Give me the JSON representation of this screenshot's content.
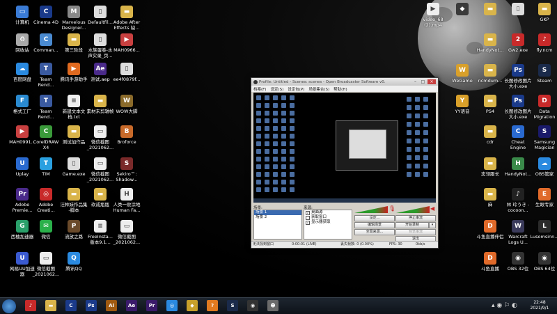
{
  "desktop_icons": [
    {
      "label": "计算机",
      "icon": "computer-icon",
      "color": "#3a7bd5",
      "glyph": "▭"
    },
    {
      "label": "Cinema 4D",
      "icon": "cinema4d-icon",
      "color": "#1a3a8a",
      "glyph": "C"
    },
    {
      "label": "Marvelous\nDesigner...",
      "icon": "marvelous-icon",
      "color": "#888",
      "glyph": "M"
    },
    {
      "label": "Defaultfil...",
      "icon": "file-icon",
      "color": "#ddd",
      "glyph": "▯"
    },
    {
      "label": "Adobe After\nEffects 缺...",
      "icon": "folder-icon",
      "color": "#d9b44a",
      "glyph": "▬"
    },
    {
      "label": "回收站",
      "icon": "recycle-bin-icon",
      "color": "#aaa",
      "glyph": "♻"
    },
    {
      "label": "Comman...",
      "icon": "command-icon",
      "color": "#4a8ad0",
      "glyph": "C"
    },
    {
      "label": "第三阶段",
      "icon": "folder-icon",
      "color": "#d9b44a",
      "glyph": "▬"
    },
    {
      "label": "水族蛋卷-水\n声实录_页...",
      "icon": "file-icon",
      "color": "#ddd",
      "glyph": "▯"
    },
    {
      "label": "MAH0966...",
      "icon": "video-icon",
      "color": "#c84040",
      "glyph": "▶"
    },
    {
      "label": "百度网盘",
      "icon": "baidu-icon",
      "color": "#2a8ae0",
      "glyph": "☁"
    },
    {
      "label": "Team\nRend...",
      "icon": "team-render-icon",
      "color": "#3a5aa0",
      "glyph": "T"
    },
    {
      "label": "腾讯手游助手",
      "icon": "tencent-game-icon",
      "color": "#e06a20",
      "glyph": "▶"
    },
    {
      "label": "测试.aep",
      "icon": "ae-file-icon",
      "color": "#4a2a8a",
      "glyph": "Ae"
    },
    {
      "label": "ee4f0879f...",
      "icon": "file-icon",
      "color": "#ddd",
      "glyph": "▯"
    },
    {
      "label": "格式工厂",
      "icon": "format-factory-icon",
      "color": "#2a8ad0",
      "glyph": "F"
    },
    {
      "label": "Team\nRend...",
      "icon": "team-render-icon",
      "color": "#3a5aa0",
      "glyph": "T"
    },
    {
      "label": "新建文本文\n档.txt",
      "icon": "text-file-icon",
      "color": "#eee",
      "glyph": "≡"
    },
    {
      "label": "素材未剪辑帧",
      "icon": "folder-icon",
      "color": "#d9b44a",
      "glyph": "▬"
    },
    {
      "label": "WOW大脚",
      "icon": "wow-icon",
      "color": "#8a6a2a",
      "glyph": "W"
    },
    {
      "label": "MAH0991...",
      "icon": "video-icon",
      "color": "#c84040",
      "glyph": "▶"
    },
    {
      "label": "CorelDRAW\nX4",
      "icon": "coreldraw-icon",
      "color": "#3a9a3a",
      "glyph": "C"
    },
    {
      "label": "测试加作品",
      "icon": "folder-icon",
      "color": "#d9b44a",
      "glyph": "▬"
    },
    {
      "label": "微信截图\n_2021062...",
      "icon": "image-file-icon",
      "color": "#eee",
      "glyph": "▭"
    },
    {
      "label": "Broforce",
      "icon": "broforce-icon",
      "color": "#c86a2a",
      "glyph": "B"
    },
    {
      "label": "Uplay",
      "icon": "uplay-icon",
      "color": "#2a6ad0",
      "glyph": "U"
    },
    {
      "label": "TIM",
      "icon": "tim-icon",
      "color": "#2aa0e0",
      "glyph": "T"
    },
    {
      "label": "Game.exe",
      "icon": "exe-icon",
      "color": "#ddd",
      "glyph": "▯"
    },
    {
      "label": "微信截图\n_2021062...",
      "icon": "image-file-icon",
      "color": "#eee",
      "glyph": "▭"
    },
    {
      "label": "Sekiro™:\nShadow...",
      "icon": "sekiro-icon",
      "color": "#7a2a2a",
      "glyph": "S"
    },
    {
      "label": "Adobe\nPremie...",
      "icon": "premiere-icon",
      "color": "#4a2a8a",
      "glyph": "Pr"
    },
    {
      "label": "Adobe\nCreati...",
      "icon": "creative-cloud-icon",
      "color": "#c82a2a",
      "glyph": "◎"
    },
    {
      "label": "汪林妹作品集\n-脚本",
      "icon": "folder-icon",
      "color": "#d9b44a",
      "glyph": "▬"
    },
    {
      "label": "砍戒瓶瓶",
      "icon": "folder-icon",
      "color": "#d9b44a",
      "glyph": "▬"
    },
    {
      "label": "人类一败涂地\nHuman Fa...",
      "icon": "human-fall-flat-icon",
      "color": "#eee",
      "glyph": "H"
    },
    {
      "label": "西柚加速器",
      "icon": "grapefruit-icon",
      "color": "#2aa06a",
      "glyph": "G"
    },
    {
      "label": "微信",
      "icon": "wechat-icon",
      "color": "#2ab04a",
      "glyph": "✉"
    },
    {
      "label": "流放之路",
      "icon": "path-of-exile-icon",
      "color": "#6a4a2a",
      "glyph": "P"
    },
    {
      "label": "FreeInsta...\n版本9.1...",
      "icon": "text-file-icon",
      "color": "#eee",
      "glyph": "≡"
    },
    {
      "label": "微信截图\n_2021062...",
      "icon": "image-file-icon",
      "color": "#eee",
      "glyph": "▭"
    },
    {
      "label": "网易UU加速\n器",
      "icon": "uu-icon",
      "color": "#3a5ad0",
      "glyph": "U"
    },
    {
      "label": "微信截图\n_2021062...",
      "icon": "image-file-icon",
      "color": "#eee",
      "glyph": "▭"
    },
    {
      "label": "腾讯QQ",
      "icon": "qq-icon",
      "color": "#2a8ae0",
      "glyph": "Q"
    },
    {
      "label": "video_68\n(2).mp4",
      "icon": "video-icon",
      "color": "#eee",
      "glyph": "▶"
    },
    {
      "label": "",
      "icon": "game-icon",
      "color": "#3a3a3a",
      "glyph": "◆"
    },
    {
      "label": "",
      "icon": "folder-icon",
      "color": "#d9b44a",
      "glyph": "▬"
    },
    {
      "label": "",
      "icon": "file-icon",
      "color": "#ddd",
      "glyph": "▯"
    },
    {
      "label": "GKP",
      "icon": "folder-icon",
      "color": "#d9b44a",
      "glyph": "▬"
    },
    {
      "label": "HandyNot...",
      "icon": "folder-icon",
      "color": "#d9b44a",
      "glyph": "▬"
    },
    {
      "label": "Gw2.exe",
      "icon": "gw2-icon",
      "color": "#c82a2a",
      "glyph": "2"
    },
    {
      "label": "fly.ncm",
      "icon": "netease-music-icon",
      "color": "#c82a2a",
      "glyph": "♪"
    },
    {
      "label": "WeGame",
      "icon": "wegame-icon",
      "color": "#d9a02a",
      "glyph": "W"
    },
    {
      "label": "ncmdum...",
      "icon": "folder-icon",
      "color": "#d9b44a",
      "glyph": "▬"
    },
    {
      "label": "长图修改图片\n大小.exe",
      "icon": "ps-exe-icon",
      "color": "#1a3a8a",
      "glyph": "Ps"
    },
    {
      "label": "Steam",
      "icon": "steam-icon",
      "color": "#1a2a4a",
      "glyph": "S"
    },
    {
      "label": "YY语音",
      "icon": "yy-icon",
      "color": "#d9a02a",
      "glyph": "Y"
    },
    {
      "label": "PS4",
      "icon": "folder-icon",
      "color": "#d9b44a",
      "glyph": "▬"
    },
    {
      "label": "长图修改图片\n大小.exe",
      "icon": "ps-exe-icon",
      "color": "#1a3a8a",
      "glyph": "Ps"
    },
    {
      "label": "Data\nMigration",
      "icon": "data-migration-icon",
      "color": "#c82a2a",
      "glyph": "D"
    },
    {
      "label": "cdr",
      "icon": "folder-icon",
      "color": "#d9b44a",
      "glyph": "▬"
    },
    {
      "label": "Cheat\nEngine",
      "icon": "cheat-engine-icon",
      "color": "#2a6ad0",
      "glyph": "C"
    },
    {
      "label": "Samsung\nMagician",
      "icon": "samsung-icon",
      "color": "#1a1a6a",
      "glyph": "S"
    },
    {
      "label": "志领服长",
      "icon": "folder-icon",
      "color": "#d9b44a",
      "glyph": "▬"
    },
    {
      "label": "HandyNot...",
      "icon": "handynote-icon",
      "color": "#3a8a4a",
      "glyph": "H"
    },
    {
      "label": "OBS管家",
      "icon": "obs-assistant-icon",
      "color": "#2a8ae0",
      "glyph": "☁"
    },
    {
      "label": "麻",
      "icon": "folder-icon",
      "color": "#d9b44a",
      "glyph": "▬"
    },
    {
      "label": "林 玲うき -\ncocoon...",
      "icon": "music-icon",
      "color": "#222",
      "glyph": "♪"
    },
    {
      "label": "生眼专家",
      "icon": "eye-icon",
      "color": "#e06a2a",
      "glyph": "E"
    },
    {
      "label": "斗鱼直播伴侣",
      "icon": "douyu-icon",
      "color": "#e06a2a",
      "glyph": "D"
    },
    {
      "label": "Warcraft\nLogs U...",
      "icon": "warcraft-logs-icon",
      "color": "#3a3a5a",
      "glyph": "W"
    },
    {
      "label": "Lusomsinn...",
      "icon": "app-icon",
      "color": "#2a2a2a",
      "glyph": "L"
    },
    {
      "label": "斗鱼直播",
      "icon": "douyu-live-icon",
      "color": "#e06a2a",
      "glyph": "D"
    },
    {
      "label": "OBS 32位",
      "icon": "obs-icon",
      "color": "#333",
      "glyph": "◉"
    },
    {
      "label": "OBS 64位",
      "icon": "obs-icon",
      "color": "#333",
      "glyph": "◉"
    }
  ],
  "obs": {
    "title": "Profile: Untitled - Scenes: scenes - Open Broadcaster Software v0.",
    "menu": [
      "档案(F)",
      "设定(S)",
      "设定包(P)",
      "场景集合(S)",
      "帮助(H)"
    ],
    "scenes_label": "场景:",
    "sources_label": "来源:",
    "scenes": [
      "场景 1",
      "场景 2"
    ],
    "sources": [
      "桌面源",
      "获取窗口",
      "显示器获取"
    ],
    "buttons": {
      "settings": "设定...",
      "stop_stream": "停止串流",
      "edit_scene": "编辑场景",
      "start_record": "开始录制",
      "global_sources": "全局来源...",
      "preview_stream": "预览串流",
      "exit": "退出"
    },
    "status": {
      "left": "无法找到窗口",
      "time": "0:00:01 (LIVE)",
      "dropped": "丢失帧数: 0 (0.00%)",
      "fps": "FPS: 30",
      "rate": "0kb/s"
    }
  },
  "taskbar": {
    "apps": [
      {
        "icon": "netease-music-icon",
        "glyph": "♪",
        "color": "#c82a2a"
      },
      {
        "icon": "folder-icon",
        "glyph": "▬",
        "color": "#d9b44a"
      },
      {
        "icon": "cinema4d-icon",
        "glyph": "C",
        "color": "#1a3a8a"
      },
      {
        "icon": "photoshop-icon",
        "glyph": "Ps",
        "color": "#1a3a8a"
      },
      {
        "icon": "illustrator-icon",
        "glyph": "Ai",
        "color": "#a05a10"
      },
      {
        "icon": "after-effects-icon",
        "glyph": "Ae",
        "color": "#3a1a6a"
      },
      {
        "icon": "premiere-icon",
        "glyph": "Pr",
        "color": "#3a1a6a"
      },
      {
        "icon": "chrome-icon",
        "glyph": "◎",
        "color": "#2a8ae0"
      },
      {
        "icon": "game-icon",
        "glyph": "◆",
        "color": "#c8a02a"
      },
      {
        "icon": "orange-app-icon",
        "glyph": "?",
        "color": "#e07a20"
      },
      {
        "icon": "steam-icon",
        "glyph": "S",
        "color": "#1a2a4a"
      },
      {
        "icon": "obs-icon",
        "glyph": "◉",
        "color": "#333"
      },
      {
        "icon": "game-icon",
        "glyph": "☻",
        "color": "#6a6a6a"
      }
    ],
    "time": "22:48",
    "date": "2021/9/1"
  }
}
